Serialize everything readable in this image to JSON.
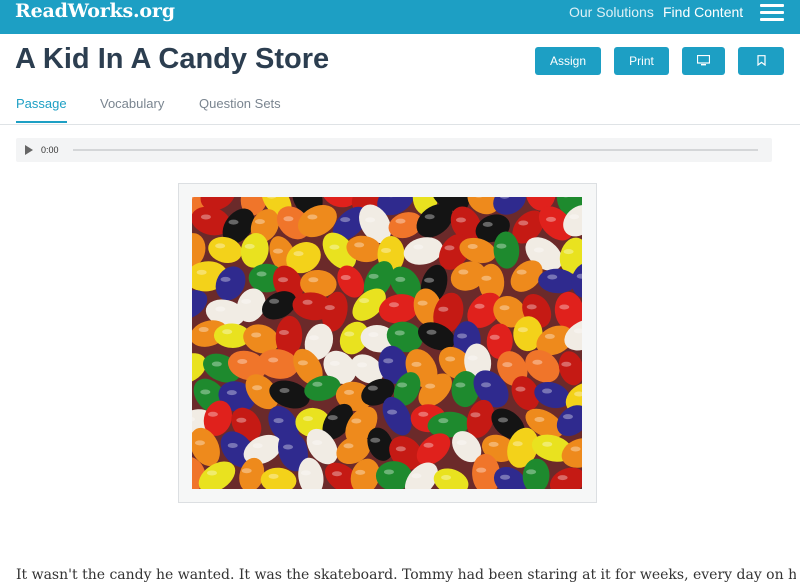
{
  "theme": {
    "brand": "#1d9fc4"
  },
  "topbar": {
    "logo": "ReadWorks.org",
    "nav": {
      "solutions": "Our Solutions",
      "find_content": "Find Content"
    },
    "menu_icon": "hamburger-menu-icon"
  },
  "header": {
    "title": "A Kid In A Candy Store",
    "buttons": {
      "assign": "Assign",
      "print": "Print",
      "present_icon": "monitor-icon",
      "bookmark_icon": "bookmark-icon"
    },
    "tabs": {
      "passage": "Passage",
      "vocabulary": "Vocabulary",
      "question_sets": "Question Sets"
    }
  },
  "audio": {
    "time": "0:00",
    "play_icon": "play-icon"
  },
  "figure": {
    "image": "jelly-beans-photo"
  },
  "passage": {
    "first_line": "It wasn't the candy he wanted. It was the skateboard. Tommy had been staring at it for weeks, every day on his"
  }
}
